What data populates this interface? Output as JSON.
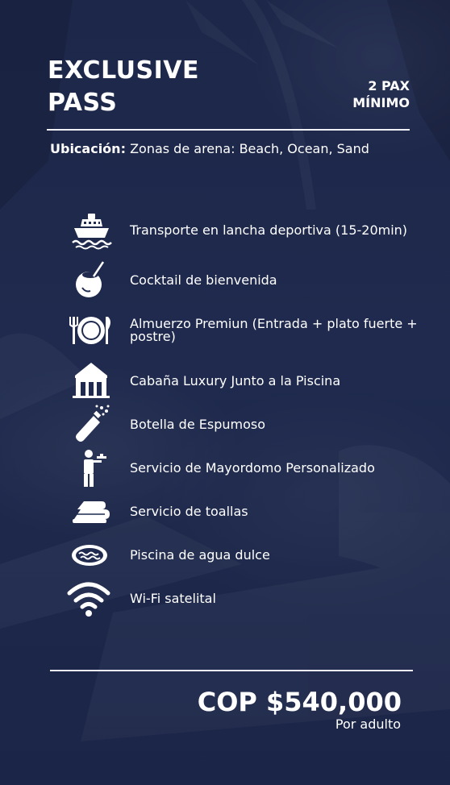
{
  "title_lines": [
    "EXCLUSIVE",
    "PASS"
  ],
  "minimum_lines": [
    "2 PAX",
    "MÍNIMO"
  ],
  "location": {
    "label": "Ubicación:",
    "value": "Zonas de arena: Beach, Ocean, Sand"
  },
  "features": [
    {
      "icon": "speedboat-icon",
      "label": "Transporte en lancha deportiva (15-20min)"
    },
    {
      "icon": "coconut-cocktail-icon",
      "label": "Cocktail de bienvenida"
    },
    {
      "icon": "plate-cutlery-icon",
      "label": "Almuerzo Premiun (Entrada + plato fuerte + postre)"
    },
    {
      "icon": "cabana-icon",
      "label": "Cabaña Luxury Junto a la Piscina"
    },
    {
      "icon": "sparkling-bottle-icon",
      "label": "Botella de Espumoso"
    },
    {
      "icon": "butler-icon",
      "label": "Servicio de Mayordomo Personalizado"
    },
    {
      "icon": "towels-icon",
      "label": "Servicio de toallas"
    },
    {
      "icon": "pool-icon",
      "label": "Piscina de agua dulce"
    },
    {
      "icon": "wifi-icon",
      "label": "Wi-Fi satelital"
    }
  ],
  "price": {
    "amount": "COP $540,000",
    "unit": "Por adulto"
  },
  "colors": {
    "background": "#1f2a4e",
    "text": "#ffffff",
    "rule": "#eef0f6"
  }
}
